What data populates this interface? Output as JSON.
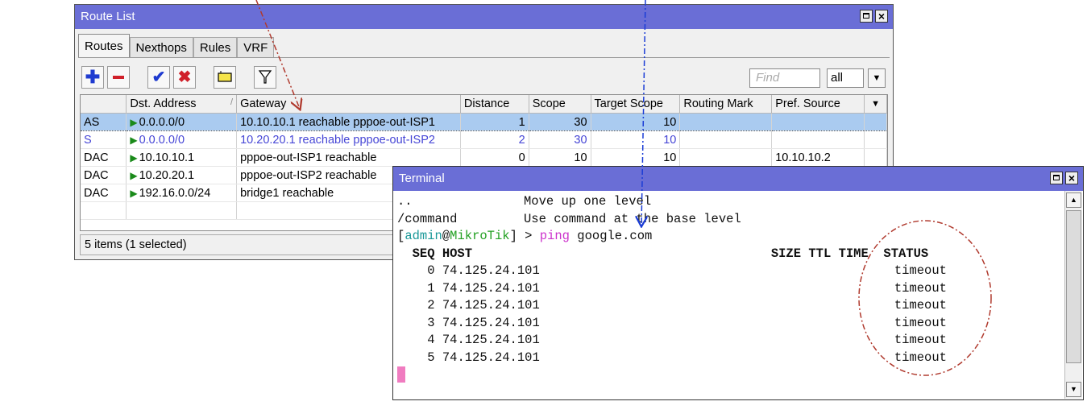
{
  "route_list": {
    "title": "Route List",
    "tabs": [
      {
        "label": "Routes",
        "active": true
      },
      {
        "label": "Nexthops",
        "active": false
      },
      {
        "label": "Rules",
        "active": false
      },
      {
        "label": "VRF",
        "active": false
      }
    ],
    "toolbar_icons": [
      "add-icon",
      "remove-icon",
      "enable-check-icon",
      "disable-x-icon",
      "comment-note-icon",
      "filter-icon"
    ],
    "find_placeholder": "Find",
    "filter_value": "all",
    "columns": [
      "",
      "Dst. Address",
      "Gateway",
      "Distance",
      "Scope",
      "Target Scope",
      "Routing Mark",
      "Pref. Source"
    ],
    "rows": [
      {
        "flags": "AS",
        "dst": "0.0.0.0/0",
        "gateway": "10.10.10.1 reachable pppoe-out-ISP1",
        "distance": "1",
        "scope": "30",
        "target_scope": "10",
        "routing_mark": "",
        "pref_source": "",
        "selected": true,
        "style": "active"
      },
      {
        "flags": "S",
        "dst": "0.0.0.0/0",
        "gateway": "10.20.20.1 reachable pppoe-out-ISP2",
        "distance": "2",
        "scope": "30",
        "target_scope": "10",
        "routing_mark": "",
        "pref_source": "",
        "selected": false,
        "style": "static"
      },
      {
        "flags": "DAC",
        "dst": "10.10.10.1",
        "gateway": "pppoe-out-ISP1 reachable",
        "distance": "0",
        "scope": "10",
        "target_scope": "10",
        "routing_mark": "",
        "pref_source": "10.10.10.2",
        "selected": false,
        "style": "normal"
      },
      {
        "flags": "DAC",
        "dst": "10.20.20.1",
        "gateway": "pppoe-out-ISP2 reachable",
        "distance": "",
        "scope": "",
        "target_scope": "",
        "routing_mark": "",
        "pref_source": "",
        "selected": false,
        "style": "normal"
      },
      {
        "flags": "DAC",
        "dst": "192.16.0.0/24",
        "gateway": "bridge1 reachable",
        "distance": "",
        "scope": "",
        "target_scope": "",
        "routing_mark": "",
        "pref_source": "",
        "selected": false,
        "style": "normal"
      }
    ],
    "status": "5 items (1 selected)"
  },
  "terminal": {
    "title": "Terminal",
    "help_lines": [
      {
        "cmd": "..",
        "desc": "Move up one level"
      },
      {
        "cmd": "/command",
        "desc": "Use command at the base level"
      }
    ],
    "prompt": {
      "user": "admin",
      "at": "@",
      "host": "MikroTik",
      "arrow": " > ",
      "command": "ping",
      "arg": " google.com"
    },
    "ping_header": {
      "seq": "SEQ",
      "host": "HOST",
      "size": "SIZE",
      "ttl": "TTL",
      "time": "TIME",
      "status": "STATUS"
    },
    "ping_rows": [
      {
        "seq": "0",
        "host": "74.125.24.101",
        "status": "timeout"
      },
      {
        "seq": "1",
        "host": "74.125.24.101",
        "status": "timeout"
      },
      {
        "seq": "2",
        "host": "74.125.24.101",
        "status": "timeout"
      },
      {
        "seq": "3",
        "host": "74.125.24.101",
        "status": "timeout"
      },
      {
        "seq": "4",
        "host": "74.125.24.101",
        "status": "timeout"
      },
      {
        "seq": "5",
        "host": "74.125.24.101",
        "status": "timeout"
      }
    ]
  },
  "colors": {
    "titlebar": "#6a6ed6",
    "selected_row": "#aacbf0",
    "static_route_text": "#4646d6",
    "annotation_red": "#b03a2e",
    "annotation_blue": "#1a3cd6",
    "prompt_teal": "#1a9999",
    "prompt_green": "#22a022",
    "command_magenta": "#cc33cc",
    "cursor_pink": "#f07cc0"
  }
}
